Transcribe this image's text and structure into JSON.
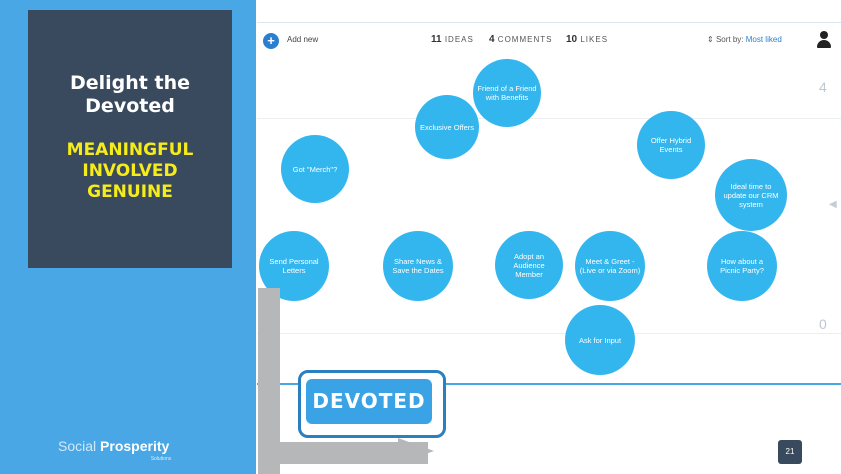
{
  "slide": {
    "title": "Delight the Devoted",
    "keywords": [
      "MEANINGFUL",
      "INVOLVED",
      "GENUINE"
    ],
    "brand": {
      "part1": "Social ",
      "part2": "Prosperity",
      "tagline": "Solutions"
    },
    "page_number": "21",
    "devoted_label": "DEVOTED"
  },
  "toolbar": {
    "add_label": "Add new",
    "ideas_count": "11",
    "ideas_label": "IDEAS",
    "comments_count": "4",
    "comments_label": "COMMENTS",
    "likes_count": "10",
    "likes_label": "LIKES",
    "sort_label": "Sort by:",
    "sort_value": "Most liked"
  },
  "axis": {
    "top": "4",
    "bottom": "0"
  },
  "ideas": [
    "Friend of a Friend with Benefits",
    "Exclusive Offers",
    "Offer Hybrid Events",
    "Got \"Merch\"?",
    "Ideal time to update our CRM system",
    "Send Personal Letters",
    "Share News & Save the Dates",
    "Adopt an Audience Member",
    "Meet & Greet - (Live or via Zoom)",
    "How about a Picnic Party?",
    "Ask for Input"
  ],
  "colors": {
    "accent": "#4aa7e6",
    "panel": "#3a4a5e",
    "bubble": "#33b5ee",
    "keyword": "#f5ec1a"
  }
}
